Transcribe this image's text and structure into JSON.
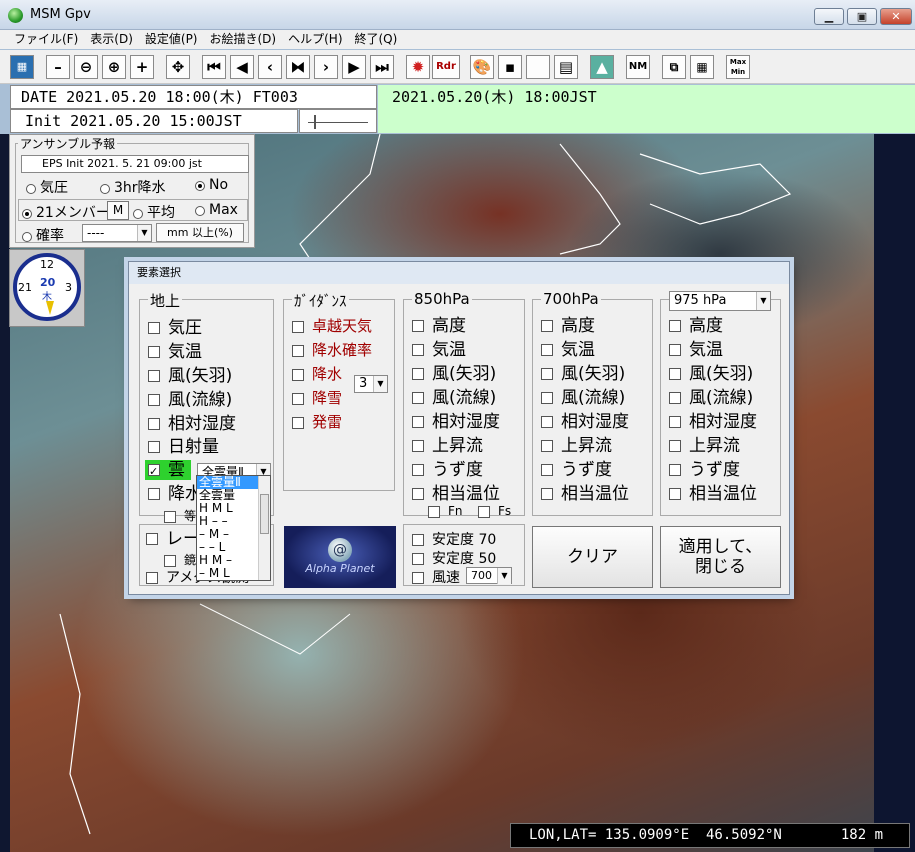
{
  "window": {
    "title": "MSM Gpv"
  },
  "menu": [
    "ファイル(F)",
    "表示(D)",
    "設定値(P)",
    "お絵描き(D)",
    "ヘルプ(H)",
    "終了(Q)"
  ],
  "toolbar": {
    "rdr_label": "Rdr",
    "nm_label": "NM",
    "minmax_label": "Max Min"
  },
  "status": {
    "date": "DATE 2021.05.20 18:00(木) FT003",
    "init": "Init 2021.05.20 15:00JST",
    "valid": "2021.05.20(木) 18:00JST"
  },
  "ensemble": {
    "title": "アンサンブル予報",
    "init_text": "EPS Init   2021. 5. 21  09:00 jst",
    "opt_pressure": "気圧",
    "opt_3hr": "3hr降水",
    "opt_no": "No",
    "opt_21": "21メンバー",
    "m_button": "M",
    "opt_avg": "平均",
    "opt_max": "Max",
    "opt_prob": "確率",
    "prob_select": "----",
    "threshold_label": "mm 以上(%)"
  },
  "clock": {
    "top": "12",
    "left": "21",
    "right": "3",
    "day": "20",
    "weekday": "木"
  },
  "dialog": {
    "title": "要素選択",
    "surface": {
      "title": "地上",
      "items": [
        "気圧",
        "気温",
        "風(矢羽)",
        "風(流線)",
        "相対湿度",
        "日射量"
      ],
      "cloud_label": "雲",
      "cloud_select": "全雲量Ⅱ",
      "precip_label": "降水",
      "equal_label": "等",
      "radar_label": "レー",
      "mirror_label": "鏡",
      "amedas_label": "アメダス観測"
    },
    "cloud_options": [
      "全雲量Ⅱ",
      "全雲量",
      "H M L",
      "H – –",
      "– M –",
      "– – L",
      "H M –",
      "– M L"
    ],
    "guidance": {
      "title": "ｶﾞｲﾀﾞﾝｽ",
      "items": [
        "卓越天気",
        "降水確率",
        "降水",
        "降雪",
        "発雷"
      ],
      "hours_select": "3"
    },
    "p850": {
      "title": "850hPa",
      "items": [
        "高度",
        "気温",
        "風(矢羽)",
        "風(流線)",
        "相対湿度",
        "上昇流",
        "うず度",
        "相当温位"
      ],
      "fn_label": "Fn",
      "fs_label": "Fs"
    },
    "p700": {
      "title": "700hPa",
      "items": [
        "高度",
        "気温",
        "風(矢羽)",
        "風(流線)",
        "相対湿度",
        "上昇流",
        "うず度",
        "相当温位"
      ]
    },
    "level_select": "975 hPa",
    "plevel": {
      "items": [
        "高度",
        "気温",
        "風(矢羽)",
        "風(流線)",
        "相対湿度",
        "上昇流",
        "うず度",
        "相当温位"
      ]
    },
    "stability70": "安定度 70",
    "stability50": "安定度 50",
    "wind_speed": "風速",
    "wind_select": "700",
    "clear_button": "クリア",
    "apply_button_l1": "適用して、",
    "apply_button_l2": "閉じる",
    "logo_text": "Alpha Planet"
  },
  "coords": "LON,LAT= 135.0909°E  46.5092°N       182 m"
}
